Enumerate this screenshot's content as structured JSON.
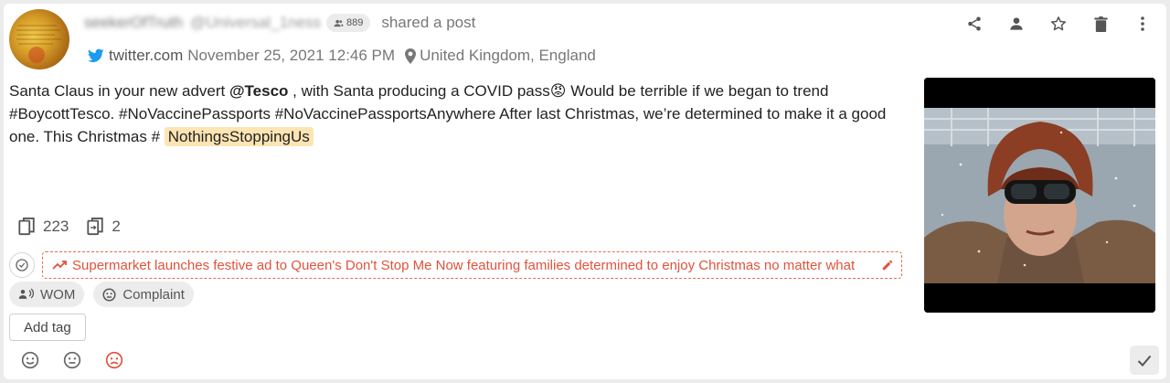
{
  "author": {
    "name": "seekerOfTruth",
    "handle": "@Universal_1ness",
    "followers": "889"
  },
  "header": {
    "shared_text": "shared a post",
    "source": "twitter.com",
    "date": "November 25, 2021 12:46 PM",
    "location": "United Kingdom, England"
  },
  "actions": [
    {
      "icon": "share-icon"
    },
    {
      "icon": "person-icon"
    },
    {
      "icon": "star-icon"
    },
    {
      "icon": "trash-icon"
    },
    {
      "icon": "more-vertical-icon"
    }
  ],
  "post": {
    "part1": "Santa Claus in your new advert ",
    "mention": "@Tesco",
    "part2": " , with Santa producing a COVID pass",
    "emoji": "😡",
    "part3": "  Would be terrible if we began to trend #BoycottTesco. #NoVaccinePassports #NoVaccinePassportsAnywhere After last Christmas, we’re determined to make it a good one. This Christmas # ",
    "highlight": "NothingsStoppingUs"
  },
  "metrics": {
    "copies": "223",
    "shares": "2"
  },
  "storyline": {
    "text": "Supermarket launches festive ad to Queen's Don't Stop Me Now featuring families determined to enjoy Christmas no matter what"
  },
  "tags": [
    {
      "icon": "megaphone-icon",
      "label": "WOM"
    },
    {
      "icon": "complaint-icon",
      "label": "Complaint"
    }
  ],
  "add_tag_label": "Add tag",
  "sentiment": {
    "selected": "negative",
    "colors": {
      "neutral": "#666666",
      "negative": "#e0533c"
    }
  },
  "colors": {
    "accent_red": "#e0533c",
    "highlight": "#fde5b3",
    "twitter_blue": "#1d9bf0"
  }
}
